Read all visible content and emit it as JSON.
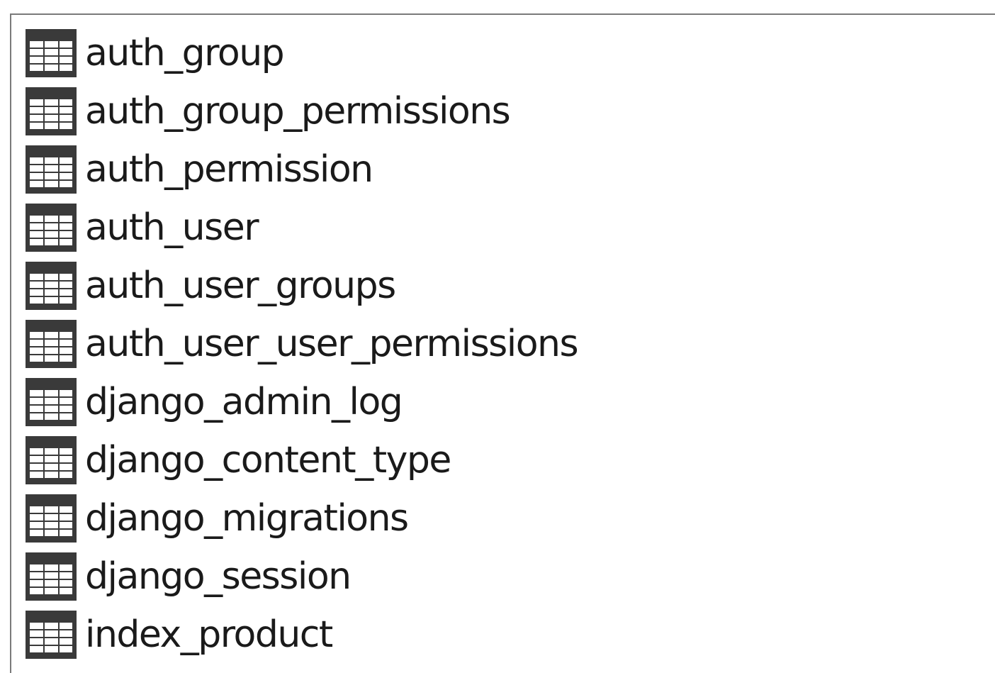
{
  "tables": [
    {
      "name": "auth_group",
      "icon": "table-icon"
    },
    {
      "name": "auth_group_permissions",
      "icon": "table-icon"
    },
    {
      "name": "auth_permission",
      "icon": "table-icon"
    },
    {
      "name": "auth_user",
      "icon": "table-icon"
    },
    {
      "name": "auth_user_groups",
      "icon": "table-icon"
    },
    {
      "name": "auth_user_user_permissions",
      "icon": "table-icon"
    },
    {
      "name": "django_admin_log",
      "icon": "table-icon"
    },
    {
      "name": "django_content_type",
      "icon": "table-icon"
    },
    {
      "name": "django_migrations",
      "icon": "table-icon"
    },
    {
      "name": "django_session",
      "icon": "table-icon"
    },
    {
      "name": "index_product",
      "icon": "table-icon"
    }
  ],
  "colors": {
    "text": "#1a1a1a",
    "icon_frame": "#3a3a3a",
    "icon_cell": "#ffffff",
    "border": "#7a7a7a"
  }
}
